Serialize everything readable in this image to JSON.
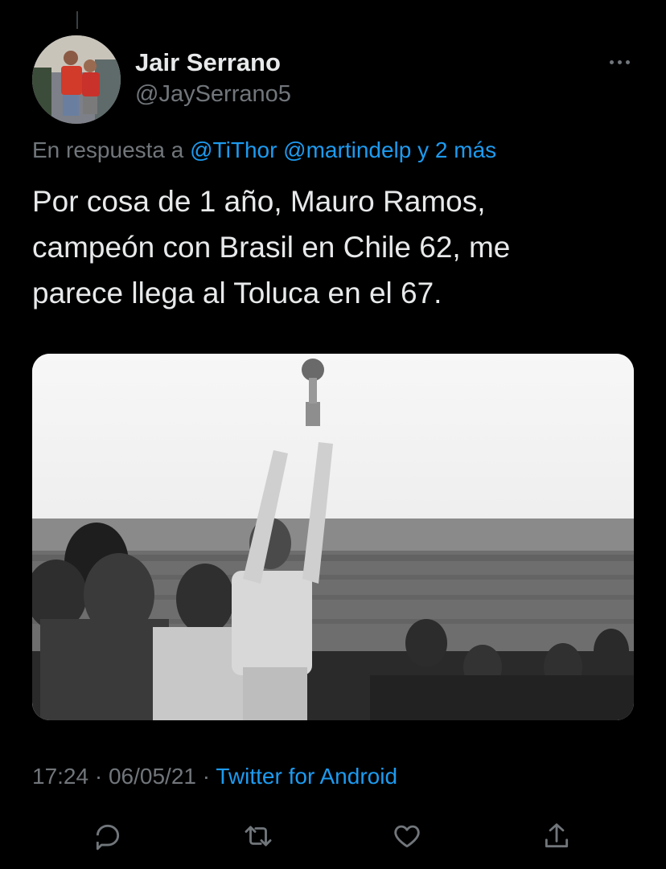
{
  "tweet": {
    "author_name": "Jair Serrano",
    "author_handle": "@JaySerrano5",
    "reply_prefix": "En respuesta a",
    "reply_mentions": "@TiThor @martindelp y 2 más",
    "text_lines": [
      "Por cosa de 1 año, Mauro Ramos,",
      "campeón con Brasil en Chile 62, me",
      "parece llega al Toluca en el 67."
    ],
    "time": "17:24",
    "separator1": " · ",
    "date": "06/05/21",
    "separator2": " · ",
    "source": "Twitter for Android"
  },
  "icons": {
    "more": "more-horizontal-icon",
    "reply": "reply-icon",
    "retweet": "retweet-icon",
    "like": "heart-icon",
    "share": "share-icon"
  },
  "colors": {
    "background": "#000000",
    "text": "#e7e9ea",
    "muted": "#71767b",
    "accent": "#1d9bf0"
  }
}
